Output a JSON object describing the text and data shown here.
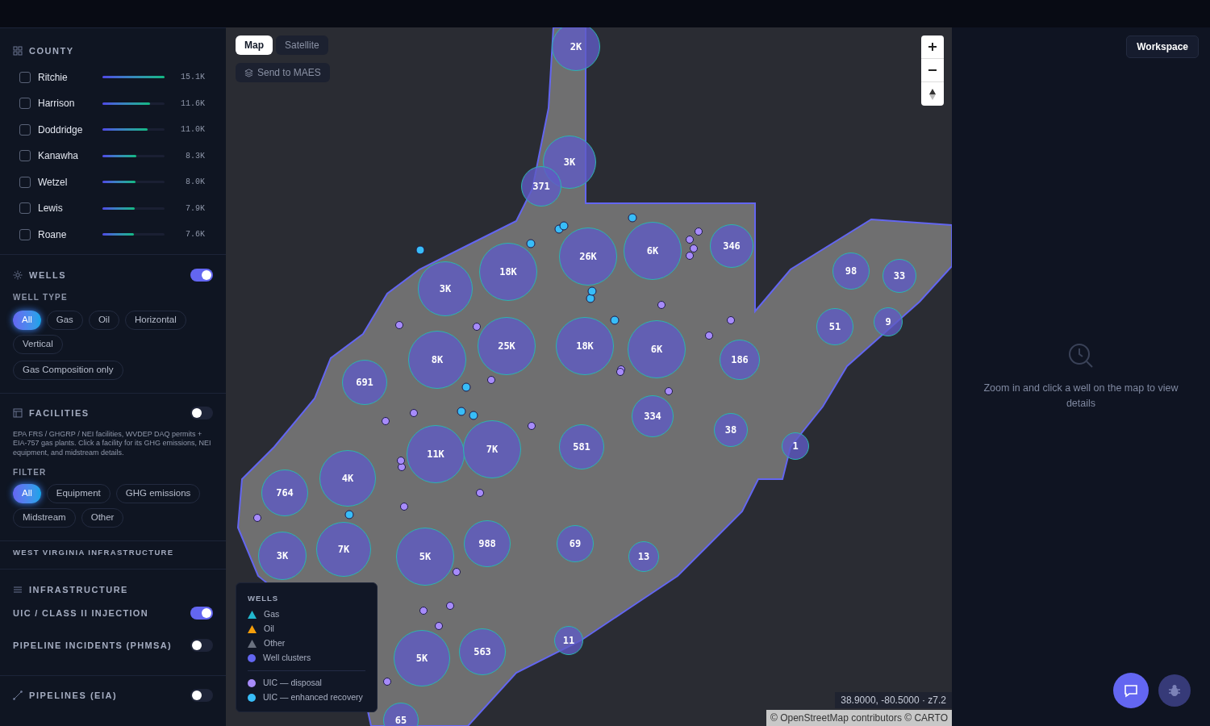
{
  "county": {
    "title": "COUNTY",
    "items": [
      {
        "name": "Ritchie",
        "checked": false,
        "level": 1.0,
        "value": "15.1K"
      },
      {
        "name": "Harrison",
        "checked": false,
        "level": 0.77,
        "value": "11.6K"
      },
      {
        "name": "Doddridge",
        "checked": false,
        "level": 0.73,
        "value": "11.0K"
      },
      {
        "name": "Kanawha",
        "checked": false,
        "level": 0.55,
        "value": "8.3K"
      },
      {
        "name": "Wetzel",
        "checked": false,
        "level": 0.53,
        "value": "8.0K"
      },
      {
        "name": "Lewis",
        "checked": false,
        "level": 0.52,
        "value": "7.9K"
      },
      {
        "name": "Roane",
        "checked": false,
        "level": 0.51,
        "value": "7.6K"
      }
    ]
  },
  "wells": {
    "title": "WELLS",
    "on": true,
    "type_label": "WELL TYPE",
    "types": [
      {
        "label": "All",
        "selected": true
      },
      {
        "label": "Gas",
        "selected": false
      },
      {
        "label": "Oil",
        "selected": false
      },
      {
        "label": "Horizontal",
        "selected": false
      },
      {
        "label": "Vertical",
        "selected": false
      }
    ],
    "extra_filter": {
      "label": "Gas Composition only",
      "selected": false
    }
  },
  "facilities": {
    "title": "FACILITIES",
    "on": false,
    "description": "EPA FRS / GHGRP / NEI facilities, WVDEP DAQ permits + EIA-757 gas plants. Click a facility for its GHG emissions, NEI equipment, and midstream details.",
    "filter_label": "FILTER",
    "filters": [
      {
        "label": "All",
        "selected": true
      },
      {
        "label": "Equipment",
        "selected": false
      },
      {
        "label": "GHG emissions",
        "selected": false
      },
      {
        "label": "Midstream",
        "selected": false
      },
      {
        "label": "Other",
        "selected": false
      }
    ]
  },
  "region_heading": "WEST VIRGINIA INFRASTRUCTURE",
  "infrastructure": {
    "title": "INFRASTRUCTURE",
    "layers": [
      {
        "label": "UIC / CLASS II INJECTION",
        "on": true
      },
      {
        "label": "PIPELINE INCIDENTS (PHMSA)",
        "on": false
      }
    ]
  },
  "pipelines": {
    "title": "PIPELINES (EIA)",
    "on": false
  },
  "map": {
    "basemap_tabs": [
      {
        "label": "Map",
        "selected": true
      },
      {
        "label": "Satellite",
        "selected": false
      }
    ],
    "send_button": "Send to MAES",
    "clusters": [
      {
        "label": "2K"
      },
      {
        "label": "3K"
      },
      {
        "label": "371"
      },
      {
        "label": "26K"
      },
      {
        "label": "6K"
      },
      {
        "label": "346"
      },
      {
        "label": "18K"
      },
      {
        "label": "98"
      },
      {
        "label": "33"
      },
      {
        "label": "3K"
      },
      {
        "label": "51"
      },
      {
        "label": "9"
      },
      {
        "label": "25K"
      },
      {
        "label": "18K"
      },
      {
        "label": "6K"
      },
      {
        "label": "8K"
      },
      {
        "label": "186"
      },
      {
        "label": "691"
      },
      {
        "label": "334"
      },
      {
        "label": "38"
      },
      {
        "label": "11K"
      },
      {
        "label": "7K"
      },
      {
        "label": "581"
      },
      {
        "label": "1"
      },
      {
        "label": "764"
      },
      {
        "label": "4K"
      },
      {
        "label": "3K"
      },
      {
        "label": "7K"
      },
      {
        "label": "5K"
      },
      {
        "label": "988"
      },
      {
        "label": "69"
      },
      {
        "label": "13"
      },
      {
        "label": "5K"
      },
      {
        "label": "563"
      },
      {
        "label": "11"
      },
      {
        "label": "65"
      }
    ],
    "legend": {
      "title": "WELLS",
      "groups": [
        [
          {
            "label": "Gas",
            "kind": "triangle",
            "color": "#22b8cf"
          },
          {
            "label": "Oil",
            "kind": "triangle",
            "color": "#f59e0b"
          },
          {
            "label": "Other",
            "kind": "triangle",
            "color": "#6b7280"
          },
          {
            "label": "Well clusters",
            "kind": "dot",
            "color": "#6366f1"
          }
        ],
        [
          {
            "label": "UIC — disposal",
            "kind": "dot",
            "color": "#a78bfa"
          },
          {
            "label": "UIC — enhanced recovery",
            "kind": "dot",
            "color": "#38bdf8"
          }
        ]
      ]
    },
    "coordinates": "38.9000, -80.5000 · z7.2",
    "attribution": "© OpenStreetMap contributors © CARTO"
  },
  "details_panel": {
    "workspace_button": "Workspace",
    "empty_message": "Zoom in and click a well on the map to view details"
  }
}
